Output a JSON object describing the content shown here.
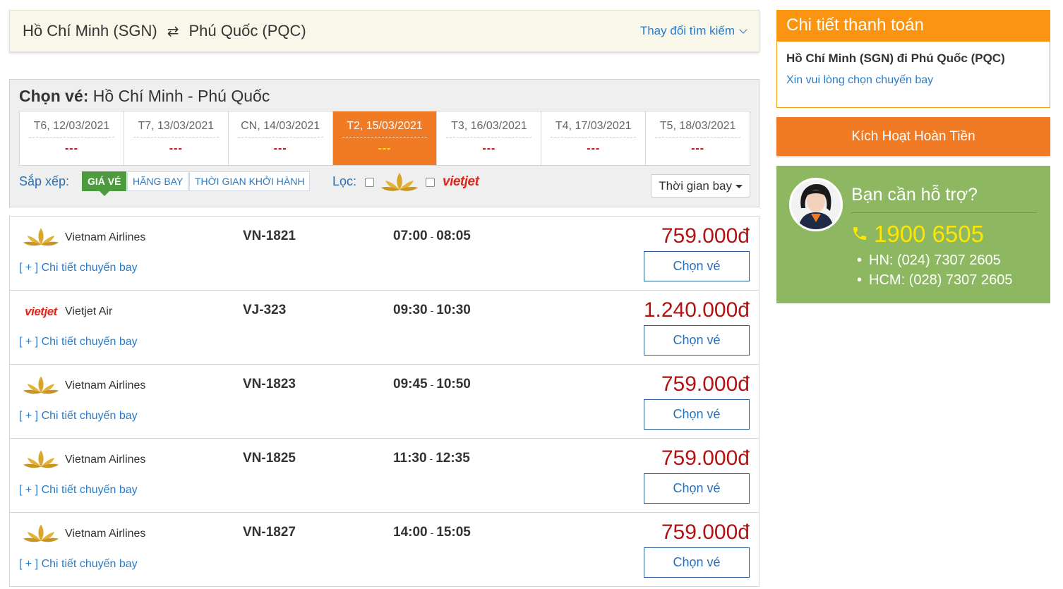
{
  "search": {
    "from": "Hồ Chí Minh (SGN)",
    "to": "Phú Quốc (PQC)",
    "change_label": "Thay đổi tìm kiếm"
  },
  "panel": {
    "title_bold": "Chọn vé:",
    "title_route": "Hồ Chí Minh - Phú Quốc"
  },
  "dates": [
    {
      "label": "T6, 12/03/2021",
      "price": "---",
      "active": false
    },
    {
      "label": "T7, 13/03/2021",
      "price": "---",
      "active": false
    },
    {
      "label": "CN, 14/03/2021",
      "price": "---",
      "active": false
    },
    {
      "label": "T2, 15/03/2021",
      "price": "---",
      "active": true
    },
    {
      "label": "T3, 16/03/2021",
      "price": "---",
      "active": false
    },
    {
      "label": "T4, 17/03/2021",
      "price": "---",
      "active": false
    },
    {
      "label": "T5, 18/03/2021",
      "price": "---",
      "active": false
    }
  ],
  "sort": {
    "label": "Sắp xếp:",
    "options": [
      "GIÁ VÉ",
      "HÃNG BAY",
      "THỜI GIAN KHỞI HÀNH"
    ],
    "filter_label": "Lọc:",
    "vietjet_logo_text": "vietjet",
    "duration_label": "Thời gian bay"
  },
  "flights": [
    {
      "airline": "Vietnam Airlines",
      "logo": "vietnam-airlines-lotus",
      "code": "VN-1821",
      "depart": "07:00",
      "arrive": "08:05",
      "price": "759.000đ",
      "detail": "[ + ] Chi tiết chuyến bay",
      "cta": "Chọn vé"
    },
    {
      "airline": "Vietjet Air",
      "logo": "vietjet",
      "code": "VJ-323",
      "depart": "09:30",
      "arrive": "10:30",
      "price": "1.240.000đ",
      "detail": "[ + ] Chi tiết chuyến bay",
      "cta": "Chọn vé"
    },
    {
      "airline": "Vietnam Airlines",
      "logo": "vietnam-airlines-lotus",
      "code": "VN-1823",
      "depart": "09:45",
      "arrive": "10:50",
      "price": "759.000đ",
      "detail": "[ + ] Chi tiết chuyến bay",
      "cta": "Chọn vé"
    },
    {
      "airline": "Vietnam Airlines",
      "logo": "vietnam-airlines-lotus",
      "code": "VN-1825",
      "depart": "11:30",
      "arrive": "12:35",
      "price": "759.000đ",
      "detail": "[ + ] Chi tiết chuyến bay",
      "cta": "Chọn vé"
    },
    {
      "airline": "Vietnam Airlines",
      "logo": "vietnam-airlines-lotus",
      "code": "VN-1827",
      "depart": "14:00",
      "arrive": "15:05",
      "price": "759.000đ",
      "detail": "[ + ] Chi tiết chuyến bay",
      "cta": "Chọn vé"
    }
  ],
  "payment": {
    "title": "Chi tiết thanh toán",
    "route": "Hồ Chí Minh (SGN) đi Phú Quốc (PQC)",
    "hint": "Xin vui lòng chọn chuyến bay"
  },
  "activate": {
    "label": "Kích Hoạt Hoàn Tiền"
  },
  "support": {
    "title": "Bạn cần hỗ trợ?",
    "hotline": "1900 6505",
    "branches": [
      "HN: (024) 7307 2605",
      "HCM: (028) 7307 2605"
    ]
  },
  "colors": {
    "accent": "#f07b24",
    "price": "#b31212",
    "link": "#2a7bc7",
    "support_bg": "#8db861",
    "hotline": "#ffe600"
  }
}
